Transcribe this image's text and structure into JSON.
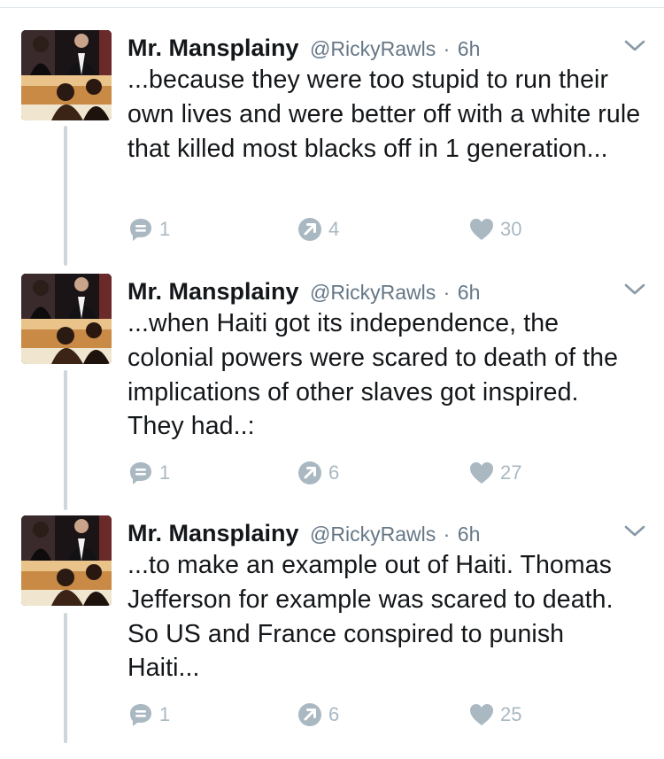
{
  "tweets": [
    {
      "name": "Mr. Mansplainy",
      "handle": "@RickyRawls",
      "sep": "·",
      "time": "6h",
      "text": "...because they were too stupid to run their own lives and were better off with a white rule that killed most blacks off in 1 generation...",
      "replies": "1",
      "retweets": "4",
      "likes": "30"
    },
    {
      "name": "Mr. Mansplainy",
      "handle": "@RickyRawls",
      "sep": "·",
      "time": "6h",
      "text": "...when Haiti got its independence, the colonial powers were scared to death of the implications of other slaves got inspired. They had..:",
      "replies": "1",
      "retweets": "6",
      "likes": "27"
    },
    {
      "name": "Mr. Mansplainy",
      "handle": "@RickyRawls",
      "sep": "·",
      "time": "6h",
      "text": "...to make an example out of Haiti. Thomas Jefferson for example was scared to death. So US and France conspired to punish Haiti...",
      "replies": "1",
      "retweets": "6",
      "likes": "25"
    }
  ],
  "icons": {
    "reply": "reply-icon",
    "retweet": "retweet-icon",
    "like": "heart-icon",
    "caret": "chevron-down-icon"
  },
  "colors": {
    "icon": "#aab8c2",
    "handle": "#657786",
    "text": "#14171a",
    "thread_line": "#cbd6dd"
  }
}
